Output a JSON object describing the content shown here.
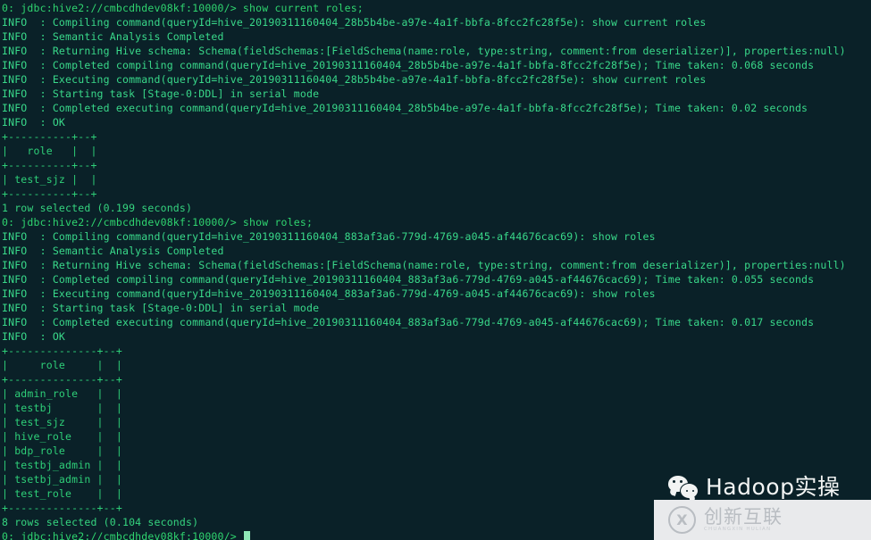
{
  "terminal": {
    "background_color": "#0a2128",
    "text_color": "#3fe08a",
    "prompt_color": "#2fd46f",
    "cursor_color": "#8fe9b8",
    "connection_string": "0: jdbc:hive2://cmbcdhdev08kf:10000/>",
    "query_id_1": "hive_20190311160404_28b5b4be-a97e-4a1f-bbfa-8fcc2fc28f5e",
    "query_id_2": "hive_20190311160404_883af3a6-779d-4769-a045-af44676cac69",
    "commands": [
      "show current roles;",
      "show roles;"
    ],
    "lines": [
      {
        "kind": "prompt",
        "text": "0: jdbc:hive2://cmbcdhdev08kf:10000/> show current roles;"
      },
      {
        "kind": "info",
        "text": "INFO  : Compiling command(queryId=hive_20190311160404_28b5b4be-a97e-4a1f-bbfa-8fcc2fc28f5e): show current roles"
      },
      {
        "kind": "info",
        "text": "INFO  : Semantic Analysis Completed"
      },
      {
        "kind": "info",
        "text": "INFO  : Returning Hive schema: Schema(fieldSchemas:[FieldSchema(name:role, type:string, comment:from deserializer)], properties:null)"
      },
      {
        "kind": "info",
        "text": "INFO  : Completed compiling command(queryId=hive_20190311160404_28b5b4be-a97e-4a1f-bbfa-8fcc2fc28f5e); Time taken: 0.068 seconds"
      },
      {
        "kind": "info",
        "text": "INFO  : Executing command(queryId=hive_20190311160404_28b5b4be-a97e-4a1f-bbfa-8fcc2fc28f5e): show current roles"
      },
      {
        "kind": "info",
        "text": "INFO  : Starting task [Stage-0:DDL] in serial mode"
      },
      {
        "kind": "info",
        "text": "INFO  : Completed executing command(queryId=hive_20190311160404_28b5b4be-a97e-4a1f-bbfa-8fcc2fc28f5e); Time taken: 0.02 seconds"
      },
      {
        "kind": "info",
        "text": "INFO  : OK"
      },
      {
        "kind": "table",
        "text": "+----------+--+"
      },
      {
        "kind": "table",
        "text": "|   role   |  |"
      },
      {
        "kind": "table",
        "text": "+----------+--+"
      },
      {
        "kind": "table",
        "text": "| test_sjz |  |"
      },
      {
        "kind": "table",
        "text": "+----------+--+"
      },
      {
        "kind": "result",
        "text": "1 row selected (0.199 seconds)"
      },
      {
        "kind": "prompt",
        "text": "0: jdbc:hive2://cmbcdhdev08kf:10000/> show roles;"
      },
      {
        "kind": "info",
        "text": "INFO  : Compiling command(queryId=hive_20190311160404_883af3a6-779d-4769-a045-af44676cac69): show roles"
      },
      {
        "kind": "info",
        "text": "INFO  : Semantic Analysis Completed"
      },
      {
        "kind": "info",
        "text": "INFO  : Returning Hive schema: Schema(fieldSchemas:[FieldSchema(name:role, type:string, comment:from deserializer)], properties:null)"
      },
      {
        "kind": "info",
        "text": "INFO  : Completed compiling command(queryId=hive_20190311160404_883af3a6-779d-4769-a045-af44676cac69); Time taken: 0.055 seconds"
      },
      {
        "kind": "info",
        "text": "INFO  : Executing command(queryId=hive_20190311160404_883af3a6-779d-4769-a045-af44676cac69): show roles"
      },
      {
        "kind": "info",
        "text": "INFO  : Starting task [Stage-0:DDL] in serial mode"
      },
      {
        "kind": "info",
        "text": "INFO  : Completed executing command(queryId=hive_20190311160404_883af3a6-779d-4769-a045-af44676cac69); Time taken: 0.017 seconds"
      },
      {
        "kind": "info",
        "text": "INFO  : OK"
      },
      {
        "kind": "table",
        "text": "+--------------+--+"
      },
      {
        "kind": "table",
        "text": "|     role     |  |"
      },
      {
        "kind": "table",
        "text": "+--------------+--+"
      },
      {
        "kind": "table",
        "text": "| admin_role   |  |"
      },
      {
        "kind": "table",
        "text": "| testbj       |  |"
      },
      {
        "kind": "table",
        "text": "| test_sjz     |  |"
      },
      {
        "kind": "table",
        "text": "| hive_role    |  |"
      },
      {
        "kind": "table",
        "text": "| bdp_role     |  |"
      },
      {
        "kind": "table",
        "text": "| testbj_admin |  |"
      },
      {
        "kind": "table",
        "text": "| tsetbj_admin |  |"
      },
      {
        "kind": "table",
        "text": "| test_role    |  |"
      },
      {
        "kind": "table",
        "text": "+--------------+--+"
      },
      {
        "kind": "result",
        "text": "8 rows selected (0.104 seconds)"
      },
      {
        "kind": "prompt",
        "text": "0: jdbc:hive2://cmbcdhdev08kf:10000/> ",
        "cursor": true
      }
    ],
    "result_table_1": {
      "columns": [
        "role",
        ""
      ],
      "rows": [
        [
          "test_sjz",
          ""
        ]
      ],
      "row_count_text": "1 row selected (0.199 seconds)"
    },
    "result_table_2": {
      "columns": [
        "role",
        ""
      ],
      "rows": [
        [
          "admin_role",
          ""
        ],
        [
          "testbj",
          ""
        ],
        [
          "test_sjz",
          ""
        ],
        [
          "hive_role",
          ""
        ],
        [
          "bdp_role",
          ""
        ],
        [
          "testbj_admin",
          ""
        ],
        [
          "tsetbj_admin",
          ""
        ],
        [
          "test_role",
          ""
        ]
      ],
      "row_count_text": "8 rows selected (0.104 seconds)"
    }
  },
  "watermark": {
    "label": "Hadoop实操",
    "icon": "wechat-icon"
  },
  "badge": {
    "mark": "X",
    "chinese": "创新互联",
    "english": "CHUANGXIN  HULIAN"
  }
}
